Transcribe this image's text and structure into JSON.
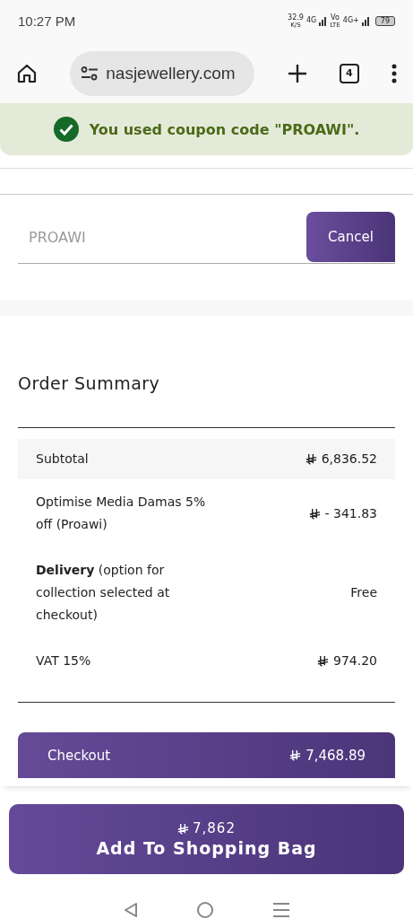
{
  "status_bar": {
    "time": "10:27 PM",
    "speed": "32.9",
    "speed_unit": "K/S",
    "net1": "4G",
    "volte_top": "Vo",
    "volte_bottom": "LTE",
    "net2": "4G+",
    "battery": "79"
  },
  "browser": {
    "url": "nasjewellery.com",
    "tab_count": "4"
  },
  "banner": {
    "message": "You used coupon code \"PROAWI\"."
  },
  "promo": {
    "value": "PROAWI",
    "button": "Cancel"
  },
  "summary": {
    "title": "Order Summary",
    "rows": [
      {
        "label": "Subtotal",
        "currency": true,
        "value": "6,836.52",
        "shaded": true
      },
      {
        "label": "Optimise Media Damas 5% off (Proawi)",
        "currency": true,
        "value": "- 341.83",
        "shaded": false
      },
      {
        "label": "**Delivery** (option for collection selected at checkout)",
        "currency": false,
        "value": "Free",
        "shaded": false
      },
      {
        "label": "VAT 15%",
        "currency": true,
        "value": "974.20",
        "shaded": false
      }
    ]
  },
  "checkout": {
    "label": "Checkout",
    "value": "7,468.89"
  },
  "add_to_bag": {
    "price": "7,862",
    "label": "Add To Shopping Bag"
  }
}
